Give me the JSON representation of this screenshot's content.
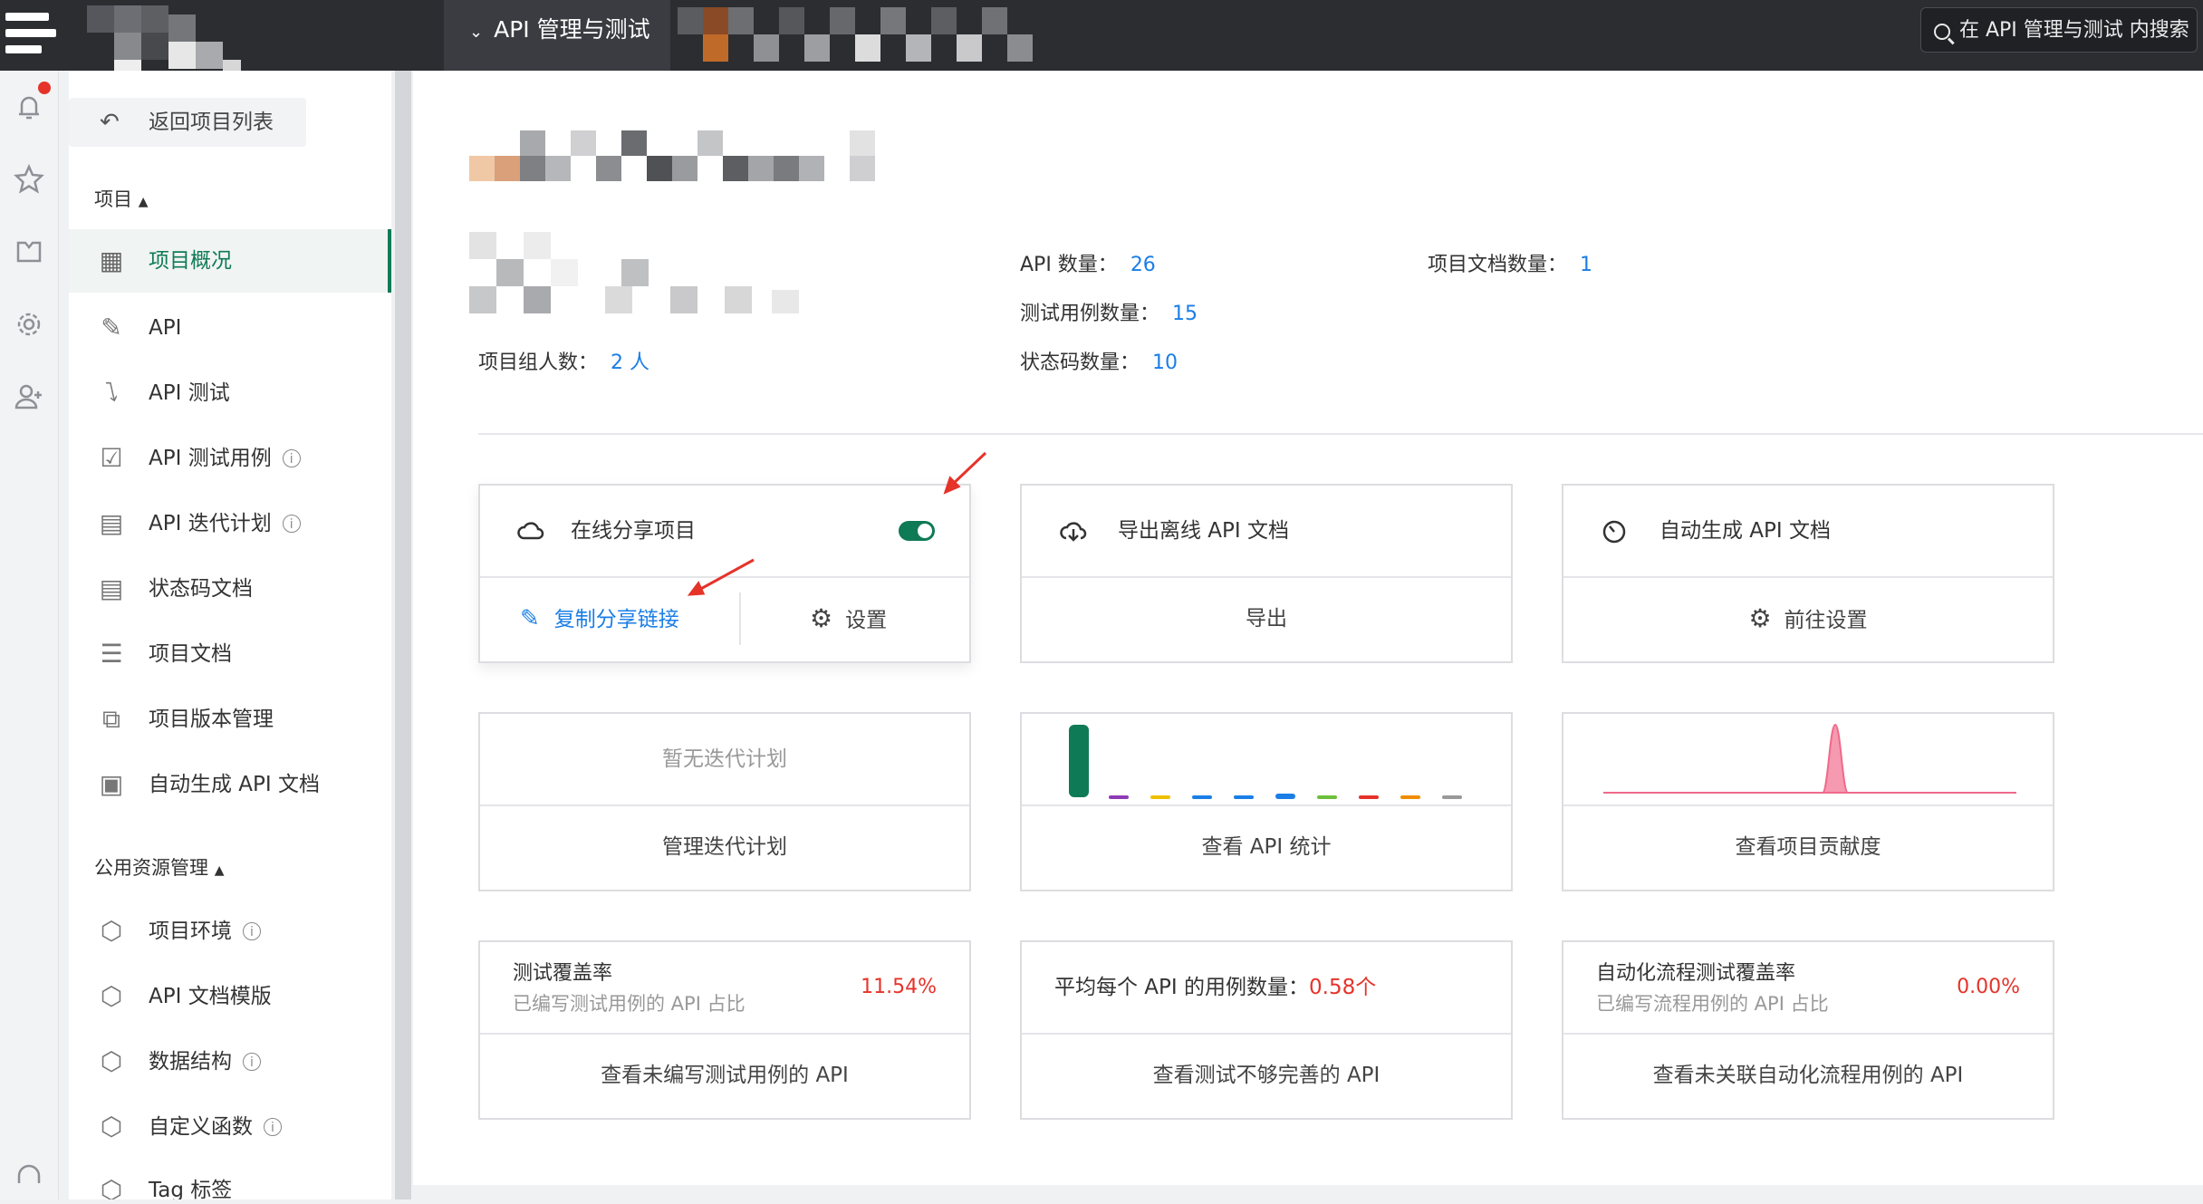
{
  "app": {
    "module_title": "API 管理与测试",
    "search_placeholder": "在 API 管理与测试 内搜索"
  },
  "rail": {
    "icons": [
      "bell-icon",
      "star-icon",
      "shirt-icon",
      "gear-icon",
      "add-user-icon",
      "headset-icon"
    ]
  },
  "sidebar": {
    "back_label": "返回项目列表",
    "group_project": "项目",
    "group_public": "公用资源管理",
    "items": [
      {
        "label": "项目概况",
        "icon": "overview-icon",
        "active": true
      },
      {
        "label": "API",
        "icon": "link-icon"
      },
      {
        "label": "API 测试",
        "icon": "lightning-icon"
      },
      {
        "label": "API 测试用例",
        "icon": "clipboard-icon",
        "info": true
      },
      {
        "label": "API 迭代计划",
        "icon": "calendar-icon",
        "info": true
      },
      {
        "label": "状态码文档",
        "icon": "doc-icon"
      },
      {
        "label": "项目文档",
        "icon": "list-icon"
      },
      {
        "label": "项目版本管理",
        "icon": "version-icon"
      },
      {
        "label": "自动生成 API 文档",
        "icon": "robot-icon"
      }
    ],
    "public_items": [
      {
        "label": "项目环境",
        "icon": "cube-icon",
        "info": true
      },
      {
        "label": "API 文档模版",
        "icon": "cube-icon"
      },
      {
        "label": "数据结构",
        "icon": "cube-icon",
        "info": true
      },
      {
        "label": "自定义函数",
        "icon": "cube-icon",
        "info": true
      },
      {
        "label": "Tag 标签",
        "icon": "cube-icon"
      }
    ]
  },
  "stats": {
    "members_label": "项目组人数：",
    "members_value": "2 人",
    "api_count_label": "API 数量：",
    "api_count_value": "26",
    "test_cases_label": "测试用例数量：",
    "test_cases_value": "15",
    "status_codes_label": "状态码数量：",
    "status_codes_value": "10",
    "project_docs_label": "项目文档数量：",
    "project_docs_value": "1"
  },
  "cards": {
    "share": {
      "title": "在线分享项目",
      "enabled": true,
      "copy_link": "复制分享链接",
      "settings": "设置"
    },
    "export": {
      "title": "导出离线 API 文档",
      "action": "导出"
    },
    "autogen": {
      "title": "自动生成 API 文档",
      "action": "前往设置"
    },
    "iteration": {
      "empty": "暂无迭代计划",
      "action": "管理迭代计划"
    },
    "api_stats": {
      "action": "查看 API 统计"
    },
    "contribution": {
      "action": "查看项目贡献度"
    },
    "coverage": {
      "title": "测试覆盖率",
      "subtitle": "已编写测试用例的 API 占比",
      "value": "11.54%",
      "action": "查看未编写测试用例的 API"
    },
    "avg_cases": {
      "title": "平均每个 API 的用例数量：",
      "value": "0.58个",
      "action": "查看测试不够完善的 API"
    },
    "flow_coverage": {
      "title": "自动化流程测试覆盖率",
      "subtitle": "已编写流程用例的 API 占比",
      "value": "0.00%",
      "action": "查看未关联自动化流程用例的 API"
    }
  },
  "colors": {
    "accent": "#0f7a56",
    "link": "#1a7ee6",
    "danger": "#e5332a",
    "mini_bars": [
      "#0f7a56",
      "#8e3ab5",
      "#f0c000",
      "#1a7ee6",
      "#1a7ee6",
      "#1a7ee6",
      "#6cbf3a",
      "#e5332a",
      "#f08c00",
      "#999999"
    ],
    "contribution_peak": "#f06a8a"
  }
}
